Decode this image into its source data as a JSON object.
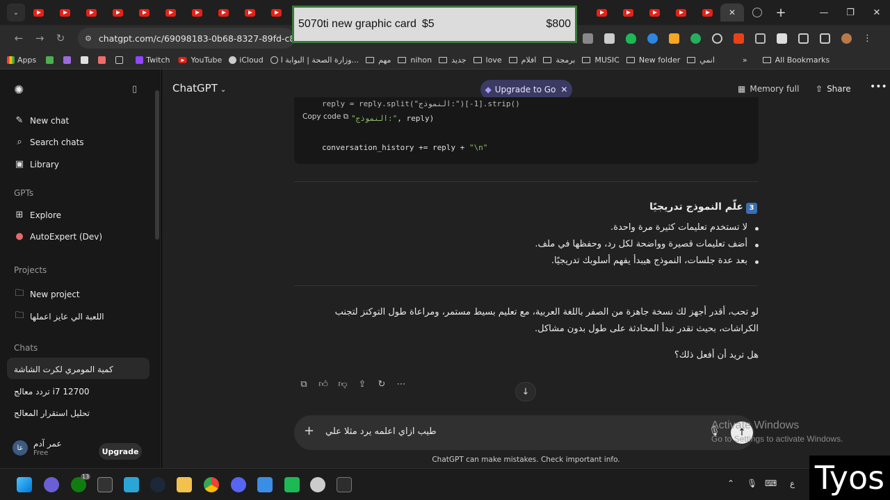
{
  "popup": {
    "title": "5070ti new graphic card",
    "price_small": "$5",
    "price": "$800"
  },
  "browser": {
    "url": "chatgpt.com/c/69098183-0b68-8327-89fd-c880587",
    "bookmarks": [
      "Apps",
      "Twitch",
      "YouTube",
      "iCloud",
      "وزارة الصحة | البوابة ا...",
      "مهم",
      "nihon",
      "جديد",
      "love",
      "افلام",
      "برمجة",
      "MUSIC",
      "New folder",
      "انمي"
    ],
    "all_bookmarks": "All Bookmarks"
  },
  "sidebar": {
    "nav": [
      "New chat",
      "Search chats",
      "Library"
    ],
    "gpts_heading": "GPTs",
    "gpts": [
      "Explore",
      "AutoExpert (Dev)"
    ],
    "projects_heading": "Projects",
    "projects": [
      "New project",
      "اللعبة الي عايز اعملها"
    ],
    "chats_heading": "Chats",
    "chats": [
      "كمية المومري لكرت الشاشة",
      "تردد معالج i7 12700",
      "تحليل استقرار المعالج"
    ],
    "user": {
      "initials": "عا",
      "name": "عمر آدم",
      "plan": "Free"
    },
    "upgrade": "Upgrade"
  },
  "header": {
    "model": "ChatGPT",
    "upgrade_pill": "Upgrade to Go",
    "memory": "Memory full",
    "share": "Share"
  },
  "code": {
    "line1": "reply = reply.split(\"النموذج:\")[-1].strip()",
    "copy": "Copy code",
    "line2_str": "\"النموذج:\"",
    "line2_rest": ", reply)",
    "line3_code": "conversation_history += reply + ",
    "line3_str": "\"\\n\""
  },
  "section": {
    "number": "3",
    "heading": "علّم النموذج تدريجيًا",
    "bullets": [
      "لا تستخدم تعليمات كثيرة مرة واحدة.",
      "أضف تعليمات قصيرة وواضحة لكل رد، وحفظها في ملف.",
      "بعد عدة جلسات، النموذج هيبدأ يفهم أسلوبك تدريجيًا."
    ]
  },
  "reply": {
    "p1": "لو تحب، أقدر أجهز لك نسخة جاهزة من الصفر باللغة العربية، مع تعليم بسيط مستمر، ومراعاة طول التوكنز لتجنب الكراشات، بحيث تقدر تبدأ المحادثة على طول بدون مشاكل.",
    "p2": "هل تريد أن أفعل ذلك؟"
  },
  "composer": {
    "value": "طيب ازاي اعلمه يرد مثلا علي"
  },
  "disclaimer": "ChatGPT can make mistakes. Check important info.",
  "watermark": {
    "line1": "Activate Windows",
    "line2": "Go to Settings to activate Windows."
  },
  "taskbar": {
    "badge": "13",
    "lang": "ع"
  },
  "overlay": "Tyos",
  "colors": {
    "accent_pill": "#3b3a63",
    "youtube": "#e62117",
    "background": "#212121",
    "sidebar": "#181818"
  }
}
